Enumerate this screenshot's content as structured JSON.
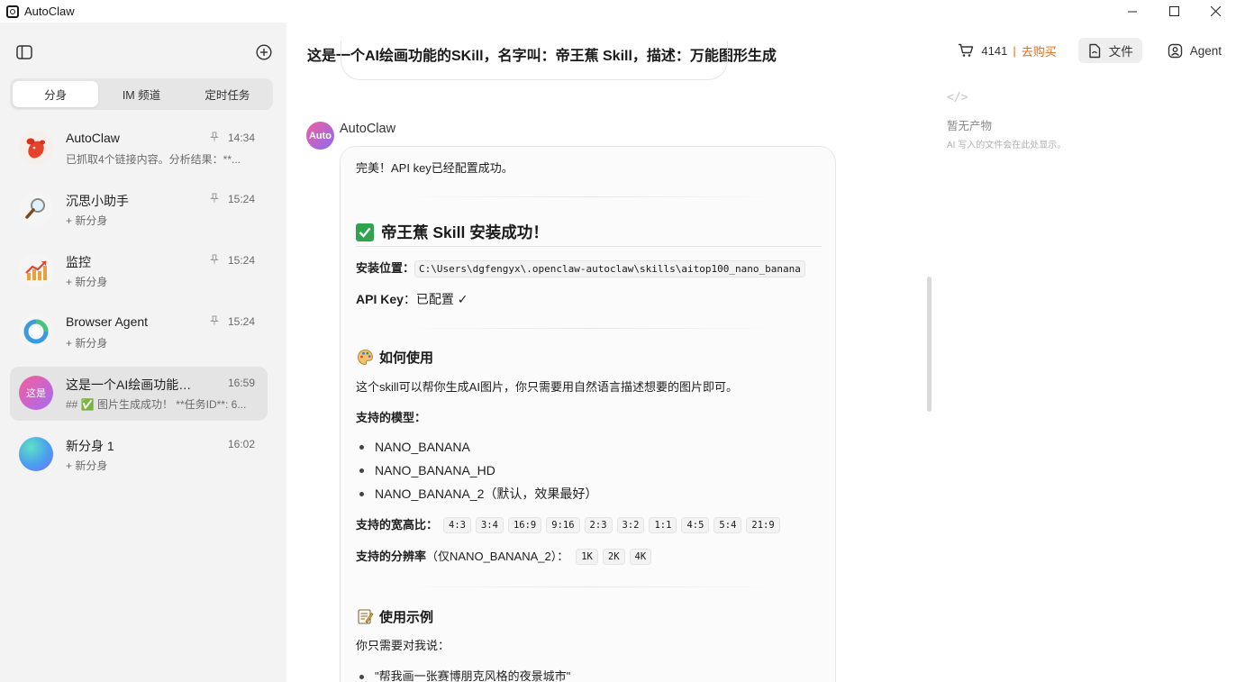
{
  "app": {
    "title": "AutoClaw"
  },
  "sidebar": {
    "tabs": [
      {
        "label": "分身",
        "active": true
      },
      {
        "label": "IM 频道",
        "active": false
      },
      {
        "label": "定时任务",
        "active": false
      }
    ],
    "conversations": [
      {
        "name": "AutoClaw",
        "subtitle": "已抓取4个链接内容。分析结果：**...",
        "time": "14:34",
        "pinned": true,
        "avatar_icon": "lobster-icon"
      },
      {
        "name": "沉思小助手",
        "subtitle": "+ 新分身",
        "time": "15:24",
        "pinned": true,
        "avatar_icon": "magnifier-icon"
      },
      {
        "name": "监控",
        "subtitle": "+ 新分身",
        "time": "15:24",
        "pinned": true,
        "avatar_icon": "chart-up-icon"
      },
      {
        "name": "Browser Agent",
        "subtitle": "+ 新分身",
        "time": "15:24",
        "pinned": true,
        "avatar_icon": "browser-ring-icon"
      },
      {
        "name": "这是一个AI绘画功能的SKill，名字叫：帝王蕉 Skill，描述：万能图形生成",
        "subtitle": "## ✅ 图片生成成功！ **任务ID**: 6...",
        "time": "16:59",
        "pinned": false,
        "avatar_text": "这是",
        "active": true
      },
      {
        "name": "新分身 1",
        "subtitle": "+ 新分身",
        "time": "16:02",
        "pinned": false,
        "avatar_icon": "gradient-orb-icon"
      }
    ]
  },
  "header": {
    "title": "这是一个AI绘画功能的SKill，名字叫：帝王蕉 Skill，描述：万能图形生成",
    "credits": "4141",
    "credits_separator": "|",
    "buy_label": "去购买",
    "files_label": "文件",
    "agent_label": "Agent"
  },
  "message": {
    "sender": "AutoClaw",
    "avatar_text": "Auto",
    "intro": "完美！API key已经配置成功。",
    "install_heading": "帝王蕉 Skill 安装成功！",
    "install_location_label": "安装位置：",
    "install_location_value": "C:\\Users\\dgfengyx\\.openclaw-autoclaw\\skills\\aitop100_nano_banana",
    "api_key_label": "API Key",
    "api_key_value": "：已配置 ✓",
    "howto_heading": "如何使用",
    "howto_desc": "这个skill可以帮你生成AI图片，你只需要用自然语言描述想要的图片即可。",
    "models_label": "支持的模型：",
    "models": [
      "NANO_BANANA",
      "NANO_BANANA_HD",
      "NANO_BANANA_2（默认，效果最好）"
    ],
    "ratios_label": "支持的宽高比：",
    "ratios": [
      "4:3",
      "3:4",
      "16:9",
      "9:16",
      "2:3",
      "3:2",
      "1:1",
      "4:5",
      "5:4",
      "21:9"
    ],
    "res_label_bold": "支持的分辨率",
    "res_label_rest": "（仅NANO_BANANA_2）：",
    "resolutions": [
      "1K",
      "2K",
      "4K"
    ],
    "examples_heading": "使用示例",
    "examples_intro": "你只需要对我说：",
    "example_1": "\"帮我画一张赛博朋克风格的夜景城市\""
  },
  "artifacts": {
    "icon": "</>",
    "title": "暂无产物",
    "desc": "AI 写入的文件会在此处显示。"
  },
  "colors": {
    "accent_orange": "#e06b1f",
    "check_green": "#2ea44f"
  }
}
